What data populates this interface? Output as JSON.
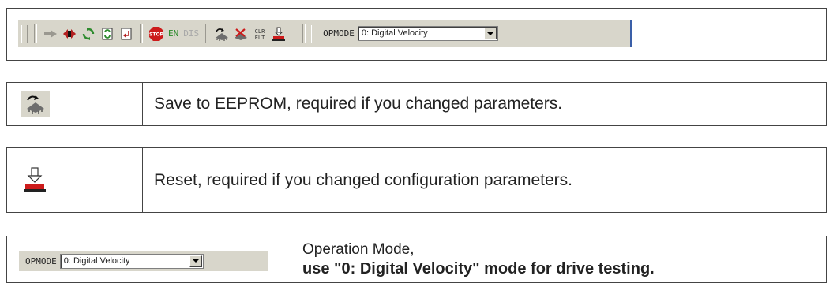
{
  "toolbar": {
    "en_label": "EN",
    "dis_label": "DIS",
    "opmode_label": "OPMODE",
    "opmode_value": "0: Digital Velocity",
    "icons": [
      "connect-icon",
      "disconnect-icon",
      "refresh-icon",
      "compare-icon",
      "download-icon",
      "stop-icon",
      "save-eeprom-icon",
      "clear-eeprom-icon",
      "clear-fault-icon",
      "reset-icon"
    ],
    "colors": {
      "background": "#d8d6cb",
      "accent": "#3a5fa8",
      "stop": "#cc1b1b",
      "enable": "#2a8a2a"
    }
  },
  "rows": {
    "save": {
      "icon": "save-eeprom-icon",
      "description": "Save to EEPROM, required if you changed parameters."
    },
    "reset": {
      "icon": "reset-icon",
      "description": "Reset, required if you changed configuration parameters."
    },
    "opmode": {
      "label": "OPMODE",
      "value": "0: Digital Velocity",
      "title": "Operation Mode,",
      "note": "use \"0: Digital Velocity\" mode for drive testing."
    }
  }
}
